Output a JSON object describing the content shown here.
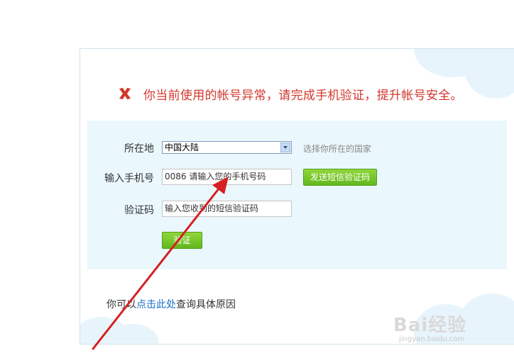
{
  "alert": {
    "message": "你当前使用的帐号异常，请完成手机验证，提升帐号安全。",
    "icon": "error-x-icon",
    "color": "#d2372c"
  },
  "form": {
    "location": {
      "label": "所在地",
      "selected": "中国大陆",
      "hint": "选择你所在的国家"
    },
    "phone": {
      "label": "输入手机号",
      "value": "0086 请输入您的手机号码",
      "send_button": "发送短信验证码"
    },
    "code": {
      "label": "验证码",
      "placeholder": "输入您收到的短信验证码"
    },
    "verify_button": "验证"
  },
  "footer": {
    "prefix": "你可以",
    "link": "点击此处",
    "suffix": "查询具体原因"
  },
  "watermark": {
    "title": "Bai经验",
    "subtitle": "jingyan.baidu.com"
  },
  "colors": {
    "accent_green": "#6cc124",
    "panel_bg": "#eaf7fd",
    "link": "#1a6fc9",
    "annotation_arrow": "#d42020"
  }
}
